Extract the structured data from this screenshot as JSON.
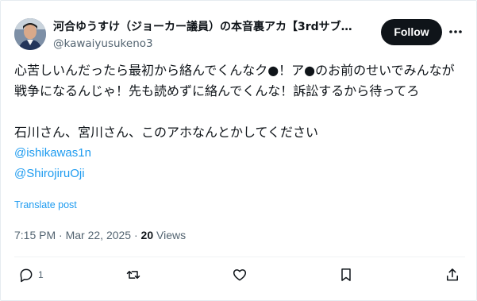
{
  "author": {
    "display_name": "河合ゆうすけ（ジョーカー議員）の本音裏アカ【3rdサブ…",
    "handle": "@kawaiyusukeno3",
    "avatar_icon": "profile-photo"
  },
  "follow_button": {
    "label": "Follow"
  },
  "tweet": {
    "paragraph1": "心苦しいんだったら最初から絡んでくんなク●！ア●のお前のせいでみんなが戦争になるんじゃ！先も読めずに絡んでくんな！訴訟するから待ってろ",
    "paragraph2": "石川さん、宮川さん、このアホなんとかしてください",
    "mentions": [
      "@ishikawas1n",
      "@ShirojiruOji"
    ]
  },
  "translate_link": "Translate post",
  "meta": {
    "time": "7:15 PM",
    "separator": "·",
    "date": "Mar 22, 2025",
    "views_count": "20",
    "views_label": "Views"
  },
  "actions": {
    "reply_count": "1",
    "icons": [
      "reply-icon",
      "retweet-icon",
      "like-icon",
      "bookmark-icon",
      "share-icon"
    ]
  },
  "colors": {
    "link": "#1d9bf0",
    "secondary_text": "#536471",
    "primary_text": "#0f1419"
  }
}
